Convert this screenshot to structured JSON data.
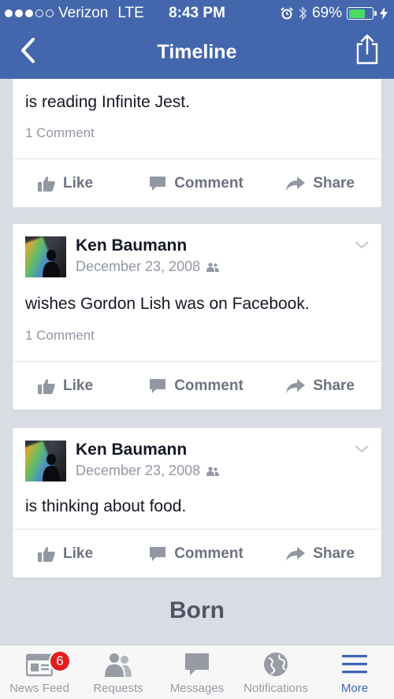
{
  "status_bar": {
    "carrier": "Verizon",
    "network": "LTE",
    "time": "8:43 PM",
    "battery": "69%",
    "battery_level": 0.69,
    "signal_bars_filled": 3,
    "signal_bars_total": 5
  },
  "nav": {
    "title": "Timeline"
  },
  "posts": [
    {
      "text": "is reading Infinite Jest.",
      "comments": "1 Comment",
      "actions": {
        "like": "Like",
        "comment": "Comment",
        "share": "Share"
      }
    },
    {
      "author": "Ken Baumann",
      "date": "December 23, 2008",
      "text": "wishes Gordon Lish was on Facebook.",
      "comments": "1 Comment",
      "actions": {
        "like": "Like",
        "comment": "Comment",
        "share": "Share"
      }
    },
    {
      "author": "Ken Baumann",
      "date": "December 23, 2008",
      "text": "is thinking about food.",
      "actions": {
        "like": "Like",
        "comment": "Comment",
        "share": "Share"
      }
    }
  ],
  "section": {
    "title": "Born"
  },
  "tabbar": {
    "tabs": [
      {
        "label": "News Feed",
        "icon": "news-feed-icon",
        "badge": "6"
      },
      {
        "label": "Requests",
        "icon": "friends-icon"
      },
      {
        "label": "Messages",
        "icon": "chat-bubble-icon"
      },
      {
        "label": "Notifications",
        "icon": "globe-icon"
      },
      {
        "label": "More",
        "icon": "hamburger-menu-icon",
        "active": true
      }
    ]
  },
  "colors": {
    "brand_blue": "#4366ad",
    "active_tab": "#4267b2",
    "badge_red": "#e41e1e",
    "battery_green": "#4cd964",
    "feed_background": "#d9dce2",
    "muted_text": "#9197a3"
  }
}
